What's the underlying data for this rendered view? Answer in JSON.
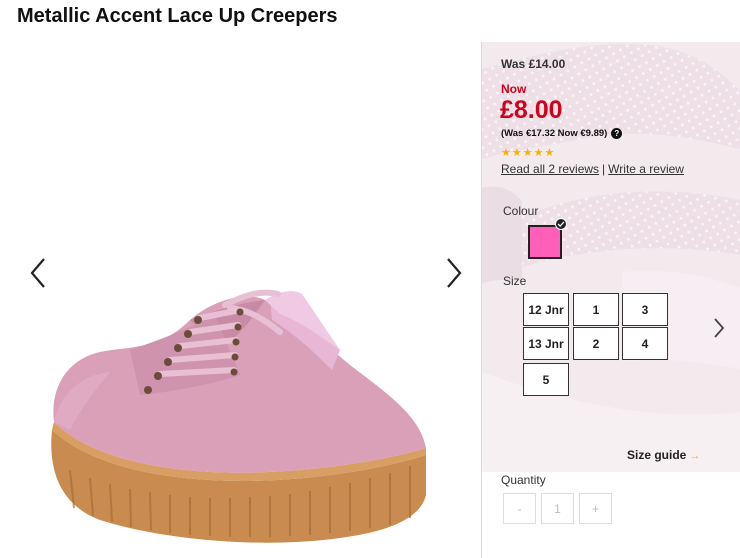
{
  "product": {
    "title": "Metallic Accent Lace Up Creepers"
  },
  "gallery": {
    "prev_icon": "chevron-left-icon",
    "next_icon": "chevron-right-icon"
  },
  "pricing": {
    "was": "Was £14.00",
    "now_label": "Now",
    "now_price": "£8.00",
    "alt_currency": "(Was €17.32 Now €9.89)",
    "help_glyph": "?",
    "accent_color": "#d0021b"
  },
  "reviews": {
    "rating": 5,
    "max_rating": 5,
    "star_color": "#f5b301",
    "read_all": "Read all 2 reviews",
    "separator": "|",
    "write": "Write a review"
  },
  "colour": {
    "label": "Colour",
    "selected_swatch": "#ff5fb8"
  },
  "size": {
    "label": "Size",
    "options": [
      "12 Jnr",
      "1",
      "3",
      "13 Jnr",
      "2",
      "4",
      "5"
    ],
    "next_icon": "chevron-right-icon",
    "guide": "Size guide",
    "guide_arrow": "→"
  },
  "quantity": {
    "label": "Quantity",
    "minus": "-",
    "value": "1",
    "plus": "+"
  }
}
